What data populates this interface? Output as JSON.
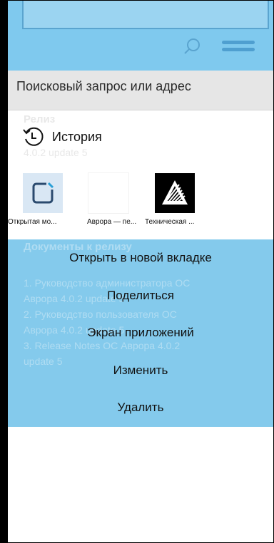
{
  "address_bar": {
    "placeholder": "Поисковый запрос или адрес"
  },
  "background_page": {
    "release_heading": "Релиз",
    "release_version": "4.0.2 update 5",
    "docs_heading": "Документы к релизу",
    "docs_lines": [
      "1. Руководство администратора ОС",
      "Аврора 4.0.2 update 5",
      "2. Руководство пользователя ОС",
      "Аврора 4.0.2 update 5",
      "3. Release Notes ОС Аврора 4.0.2",
      "update 5"
    ]
  },
  "history": {
    "label": "История",
    "icon": "history-icon"
  },
  "bookmarks": [
    {
      "caption": "Открытая мо...",
      "icon": "open-mobile-platform-logo"
    },
    {
      "caption": "Аврора — пе...",
      "icon": "blank-page"
    },
    {
      "caption": "Техническая ...",
      "icon": "aurora-logo"
    }
  ],
  "context_menu": {
    "items": [
      "Открыть в новой вкладке",
      "Поделиться",
      "Экран приложений",
      "Изменить",
      "Удалить"
    ]
  },
  "colors": {
    "accent": "#7bc6eb",
    "header": "#7fc9ee",
    "address_bg": "#e6e6e6"
  }
}
